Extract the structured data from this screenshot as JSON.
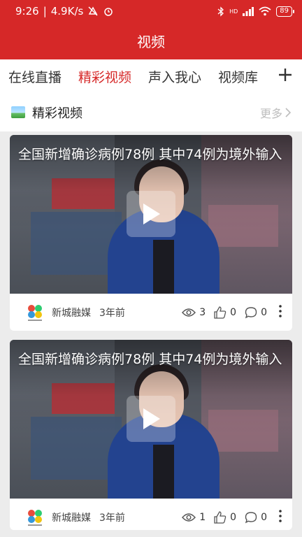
{
  "status_bar": {
    "time": "9:26",
    "net_speed": "4.9K/s",
    "signal_label": "HD",
    "battery": "89"
  },
  "header": {
    "title": "视频"
  },
  "tabs": [
    {
      "label": "在线直播",
      "active": false
    },
    {
      "label": "精彩视频",
      "active": true
    },
    {
      "label": "声入我心",
      "active": false
    },
    {
      "label": "视频库",
      "active": false
    }
  ],
  "section": {
    "title": "精彩视频",
    "more": "更多"
  },
  "videos": [
    {
      "title": "全国新增确诊病例78例  其中74例为境外输入",
      "source": "新城融媒",
      "time": "3年前",
      "views": "3",
      "likes": "0",
      "comments": "0"
    },
    {
      "title": "全国新增确诊病例78例  其中74例为境外输入",
      "source": "新城融媒",
      "time": "3年前",
      "views": "1",
      "likes": "0",
      "comments": "0"
    }
  ],
  "colors": {
    "accent": "#d62828",
    "background": "#ececec"
  }
}
